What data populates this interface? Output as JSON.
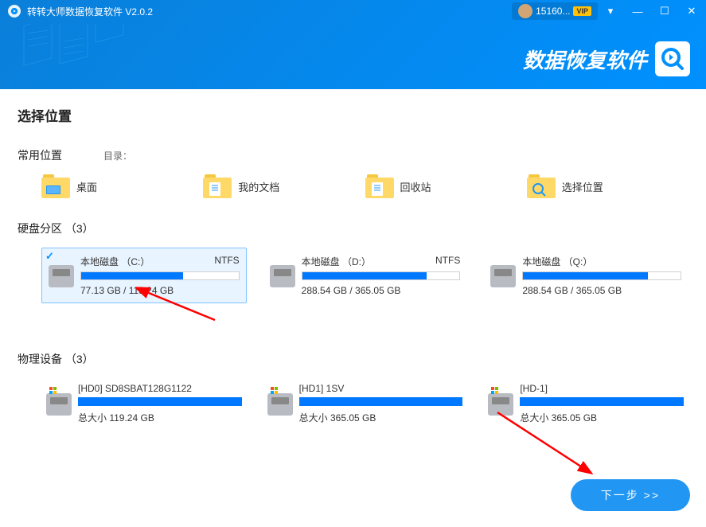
{
  "titlebar": {
    "app_title": "转转大师数据恢复软件 V2.0.2",
    "user_id": "15160...",
    "vip_label": "VIP"
  },
  "brand": {
    "text": "数据恢复软件"
  },
  "page": {
    "title": "选择位置"
  },
  "common_locations": {
    "header": "常用位置",
    "dir_label": "目录：",
    "items": [
      {
        "label": "桌面",
        "icon": "desktop"
      },
      {
        "label": "我的文档",
        "icon": "documents"
      },
      {
        "label": "回收站",
        "icon": "recycle"
      },
      {
        "label": "选择位置",
        "icon": "browse"
      }
    ]
  },
  "partitions": {
    "header": "硬盘分区 （3）",
    "items": [
      {
        "name": "本地磁盘 （C:）",
        "fs": "NTFS",
        "used": "77.13 GB",
        "total": "119.24 GB",
        "fill_pct": 64.7,
        "selected": true
      },
      {
        "name": "本地磁盘 （D:）",
        "fs": "NTFS",
        "used": "288.54 GB",
        "total": "365.05 GB",
        "fill_pct": 79.0,
        "selected": false
      },
      {
        "name": "本地磁盘 （Q:）",
        "fs": "",
        "used": "288.54 GB",
        "total": "365.05 GB",
        "fill_pct": 79.0,
        "selected": false
      }
    ]
  },
  "devices": {
    "header": "物理设备 （3）",
    "size_prefix": "总大小",
    "items": [
      {
        "name": "[HD0] SD8SBAT128G1122",
        "total": "119.24 GB"
      },
      {
        "name": "[HD1] 1SV",
        "total": "365.05 GB"
      },
      {
        "name": "[HD-1]",
        "total": "365.05 GB"
      }
    ]
  },
  "footer": {
    "next_label": "下一步 >>"
  }
}
